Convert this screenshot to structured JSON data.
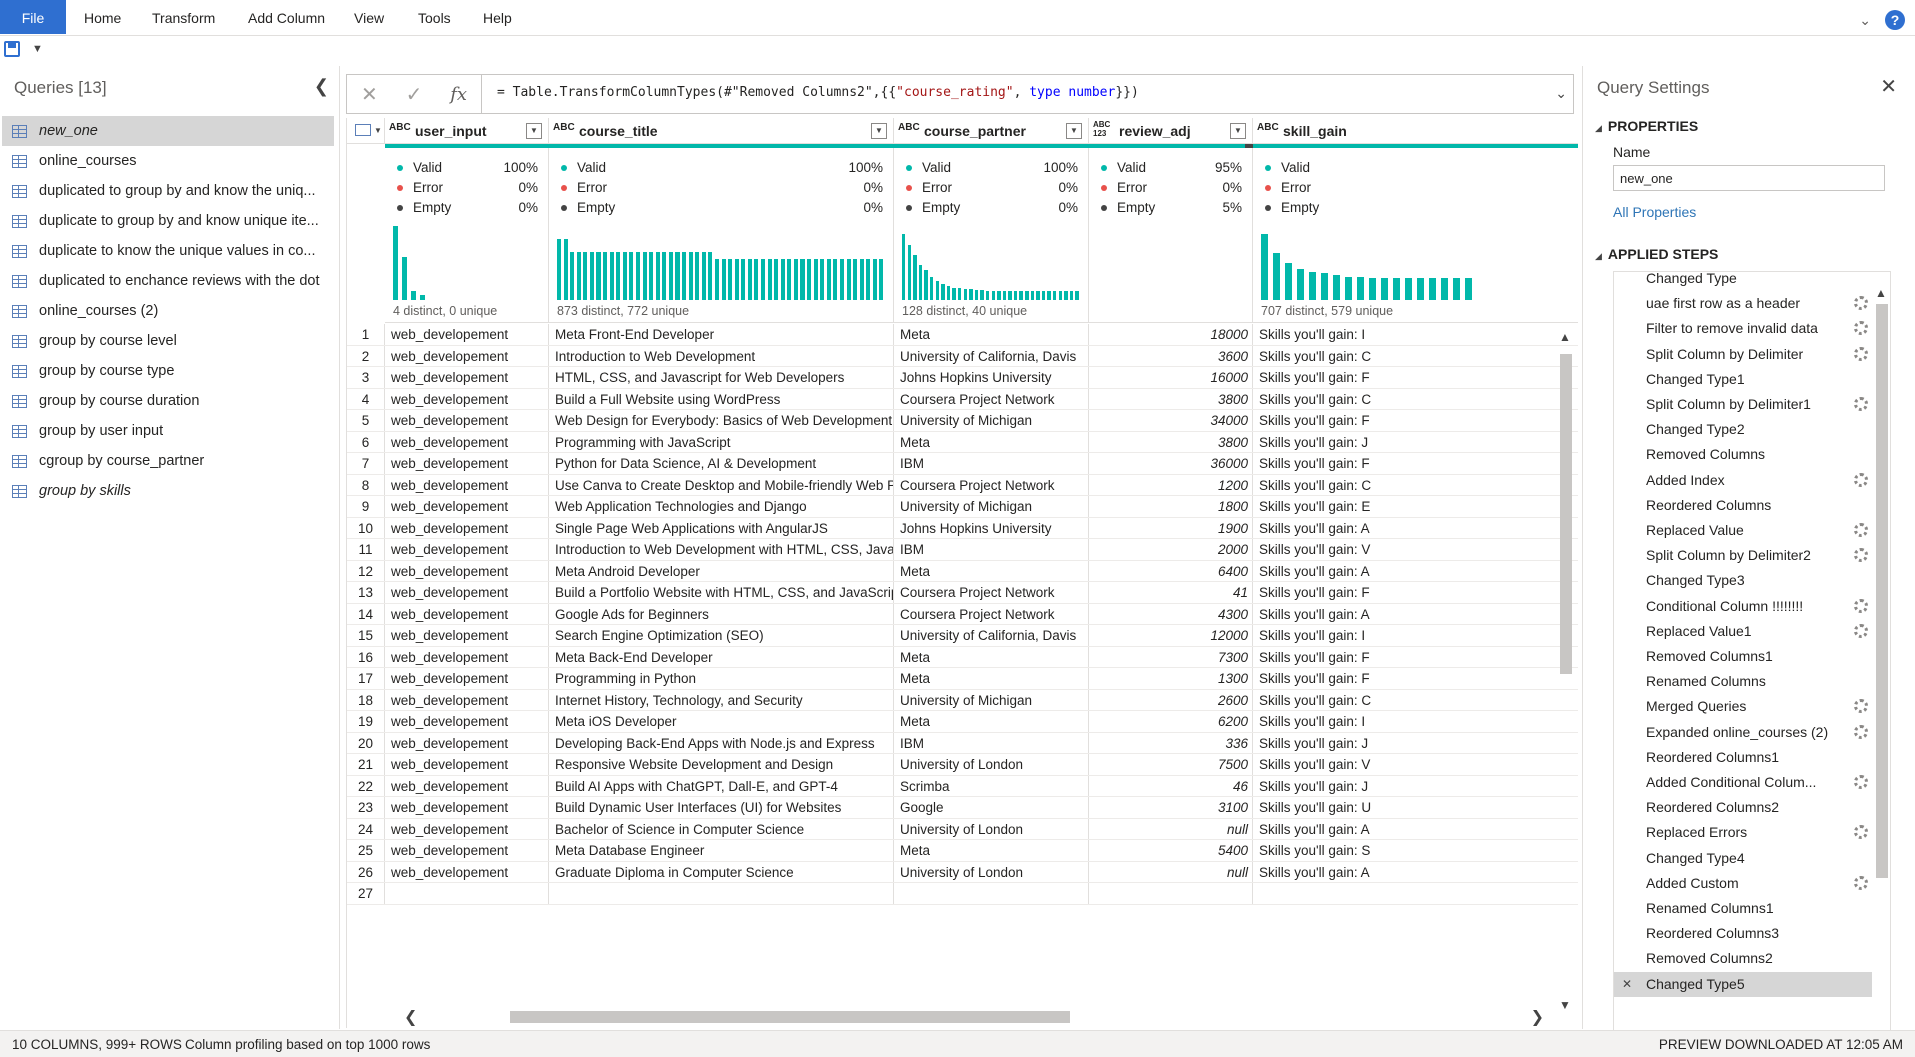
{
  "ribbon": {
    "tabs": [
      "File",
      "Home",
      "Transform",
      "Add Column",
      "View",
      "Tools",
      "Help"
    ]
  },
  "queries": {
    "title": "Queries [13]",
    "items": [
      {
        "label": "new_one",
        "selected": true,
        "italic": true
      },
      {
        "label": "online_courses"
      },
      {
        "label": "duplicated to group by and know the uniq..."
      },
      {
        "label": "duplicate to group by and know unique ite..."
      },
      {
        "label": "duplicate to know the unique values in co..."
      },
      {
        "label": "duplicated to enchance reviews with the dot"
      },
      {
        "label": "online_courses (2)"
      },
      {
        "label": "group by course level"
      },
      {
        "label": "group by course type"
      },
      {
        "label": "group by course duration"
      },
      {
        "label": "group by user input"
      },
      {
        "label": "cgroup by course_partner"
      },
      {
        "label": "group by skills",
        "italic": true
      }
    ]
  },
  "formula": {
    "part1": "= Table.TransformColumnTypes(#\"Removed Columns2\",{{",
    "part2": "\"course_rating\"",
    "part3": ", ",
    "part4": "type number",
    "part5": "}})"
  },
  "profile_labels": {
    "valid": "Valid",
    "error": "Error",
    "empty": "Empty"
  },
  "columns": [
    {
      "name": "user_input",
      "type": "ABC",
      "valid": "100%",
      "error": "0%",
      "empty": "0%",
      "summary": "4 distinct, 0 unique",
      "hist": [
        0.95,
        0.55,
        0.12,
        0.06
      ]
    },
    {
      "name": "course_title",
      "type": "ABC",
      "valid": "100%",
      "error": "0%",
      "empty": "0%",
      "summary": "873 distinct, 772 unique",
      "hist": [
        0.78,
        0.78,
        0.62,
        0.62,
        0.62,
        0.62,
        0.62,
        0.62,
        0.62,
        0.62,
        0.62,
        0.62,
        0.62,
        0.62,
        0.62,
        0.62,
        0.62,
        0.62,
        0.62,
        0.62,
        0.62,
        0.62,
        0.62,
        0.62,
        0.52,
        0.52,
        0.52,
        0.52,
        0.52,
        0.52,
        0.52,
        0.52,
        0.52,
        0.52,
        0.52,
        0.52,
        0.52,
        0.52,
        0.52,
        0.52,
        0.52,
        0.52,
        0.52,
        0.52,
        0.52,
        0.52,
        0.52,
        0.52,
        0.52,
        0.52
      ]
    },
    {
      "name": "course_partner",
      "type": "ABC",
      "valid": "100%",
      "error": "0%",
      "empty": "0%",
      "summary": "128 distinct, 40 unique",
      "hist": [
        0.85,
        0.7,
        0.58,
        0.45,
        0.38,
        0.3,
        0.24,
        0.2,
        0.18,
        0.16,
        0.15,
        0.14,
        0.14,
        0.13,
        0.13,
        0.12,
        0.12,
        0.12,
        0.12,
        0.12,
        0.11,
        0.11,
        0.11,
        0.11,
        0.11,
        0.11,
        0.11,
        0.11,
        0.11,
        0.11,
        0.11,
        0.11
      ]
    },
    {
      "name": "review_adj",
      "type": "ABC 123",
      "valid": "95%",
      "error": "0%",
      "empty": "5%",
      "summary": "",
      "hist": []
    },
    {
      "name": "skill_gain",
      "type": "ABC",
      "valid": "",
      "error": "",
      "empty": "",
      "summary": "707 distinct, 579 unique",
      "hist": [
        0.85,
        0.6,
        0.48,
        0.4,
        0.36,
        0.34,
        0.32,
        0.3,
        0.3,
        0.28,
        0.28,
        0.28,
        0.28,
        0.28,
        0.28,
        0.28,
        0.28,
        0.28
      ]
    }
  ],
  "rows": [
    [
      "web_developement",
      "Meta Front-End Developer",
      "Meta",
      "18000",
      "Skills you'll gain: I"
    ],
    [
      "web_developement",
      "Introduction to Web Development",
      "University of California, Davis",
      "3600",
      "Skills you'll gain: C"
    ],
    [
      "web_developement",
      "HTML, CSS, and Javascript for Web Developers",
      "Johns Hopkins University",
      "16000",
      "Skills you'll gain: F"
    ],
    [
      "web_developement",
      "Build a Full Website using WordPress",
      "Coursera Project Network",
      "3800",
      "Skills you'll gain: C"
    ],
    [
      "web_developement",
      "Web Design for Everybody: Basics of Web Development & Coding",
      "University of Michigan",
      "34000",
      "Skills you'll gain: F"
    ],
    [
      "web_developement",
      "Programming with JavaScript",
      "Meta",
      "3800",
      "Skills you'll gain: J"
    ],
    [
      "web_developement",
      "Python for Data Science, AI & Development",
      "IBM",
      "36000",
      "Skills you'll gain: F"
    ],
    [
      "web_developement",
      "Use Canva to Create Desktop and Mobile-friendly Web Pages.",
      "Coursera Project Network",
      "1200",
      "Skills you'll gain: C"
    ],
    [
      "web_developement",
      "Web Application Technologies and Django",
      "University of Michigan",
      "1800",
      "Skills you'll gain: E"
    ],
    [
      "web_developement",
      "Single Page Web Applications with AngularJS",
      "Johns Hopkins University",
      "1900",
      "Skills you'll gain: A"
    ],
    [
      "web_developement",
      "Introduction to Web Development with HTML, CSS, JavaScript",
      "IBM",
      "2000",
      "Skills you'll gain: V"
    ],
    [
      "web_developement",
      "Meta Android Developer",
      "Meta",
      "6400",
      "Skills you'll gain: A"
    ],
    [
      "web_developement",
      "Build a Portfolio Website with HTML, CSS, and JavaScript",
      "Coursera Project Network",
      "41",
      "Skills you'll gain: F"
    ],
    [
      "web_developement",
      "Google Ads for Beginners",
      "Coursera Project Network",
      "4300",
      "Skills you'll gain: A"
    ],
    [
      "web_developement",
      "Search Engine Optimization (SEO)",
      "University of California, Davis",
      "12000",
      "Skills you'll gain: I"
    ],
    [
      "web_developement",
      "Meta Back-End Developer",
      "Meta",
      "7300",
      "Skills you'll gain: F"
    ],
    [
      "web_developement",
      "Programming in Python",
      "Meta",
      "1300",
      "Skills you'll gain: F"
    ],
    [
      "web_developement",
      "Internet History, Technology, and Security",
      "University of Michigan",
      "2600",
      "Skills you'll gain: C"
    ],
    [
      "web_developement",
      "Meta iOS Developer",
      "Meta",
      "6200",
      "Skills you'll gain: I"
    ],
    [
      "web_developement",
      "Developing Back-End Apps with Node.js and Express",
      "IBM",
      "336",
      "Skills you'll gain: J"
    ],
    [
      "web_developement",
      "Responsive Website Development and Design",
      "University of London",
      "7500",
      "Skills you'll gain: V"
    ],
    [
      "web_developement",
      "Build AI Apps with ChatGPT, Dall-E, and GPT-4",
      "Scrimba",
      "46",
      "Skills you'll gain: J"
    ],
    [
      "web_developement",
      "Build Dynamic User Interfaces (UI) for Websites",
      "Google",
      "3100",
      "Skills you'll gain: U"
    ],
    [
      "web_developement",
      "Bachelor of Science in Computer Science",
      "University of London",
      "null",
      "Skills you'll gain: A"
    ],
    [
      "web_developement",
      "Meta Database Engineer",
      "Meta",
      "5400",
      "Skills you'll gain: S"
    ],
    [
      "web_developement",
      "Graduate Diploma in Computer Science",
      "University of London",
      "null",
      "Skills you'll gain: A"
    ],
    [
      "",
      "",
      "",
      "",
      ""
    ]
  ],
  "settings": {
    "title": "Query Settings",
    "properties_header": "PROPERTIES",
    "name_label": "Name",
    "name_value": "new_one",
    "all_properties": "All Properties",
    "applied_steps_header": "APPLIED STEPS",
    "steps": [
      {
        "label": "Changed Type",
        "gear": false
      },
      {
        "label": "uae first row as a header",
        "gear": true
      },
      {
        "label": "Filter to remove invalid data",
        "gear": true
      },
      {
        "label": "Split Column by Delimiter",
        "gear": true
      },
      {
        "label": "Changed Type1",
        "gear": false
      },
      {
        "label": "Split Column by Delimiter1",
        "gear": true
      },
      {
        "label": "Changed Type2",
        "gear": false
      },
      {
        "label": "Removed Columns",
        "gear": false
      },
      {
        "label": "Added Index",
        "gear": true
      },
      {
        "label": "Reordered Columns",
        "gear": false
      },
      {
        "label": "Replaced Value",
        "gear": true
      },
      {
        "label": "Split Column by Delimiter2",
        "gear": true
      },
      {
        "label": "Changed Type3",
        "gear": false
      },
      {
        "label": "Conditional Column !!!!!!!!",
        "gear": true
      },
      {
        "label": "Replaced Value1",
        "gear": true
      },
      {
        "label": "Removed Columns1",
        "gear": false
      },
      {
        "label": "Renamed Columns",
        "gear": false
      },
      {
        "label": "Merged Queries",
        "gear": true
      },
      {
        "label": "Expanded online_courses (2)",
        "gear": true
      },
      {
        "label": "Reordered Columns1",
        "gear": false
      },
      {
        "label": "Added Conditional Colum...",
        "gear": true
      },
      {
        "label": "Reordered Columns2",
        "gear": false
      },
      {
        "label": "Replaced Errors",
        "gear": true
      },
      {
        "label": "Changed Type4",
        "gear": false
      },
      {
        "label": "Added Custom",
        "gear": true
      },
      {
        "label": "Renamed Columns1",
        "gear": false
      },
      {
        "label": "Reordered Columns3",
        "gear": false
      },
      {
        "label": "Removed Columns2",
        "gear": false
      },
      {
        "label": "Changed Type5",
        "gear": false,
        "selected": true
      }
    ]
  },
  "status": {
    "left1": "10 COLUMNS, 999+ ROWS",
    "left2": "Column profiling based on top 1000 rows",
    "right": "PREVIEW DOWNLOADED AT 12:05 AM"
  },
  "colors": {
    "accent": "#2f6fd0",
    "profile_teal": "#01b8aa",
    "valid": "#01b8aa",
    "error": "#e8514b",
    "empty": "#444444"
  }
}
